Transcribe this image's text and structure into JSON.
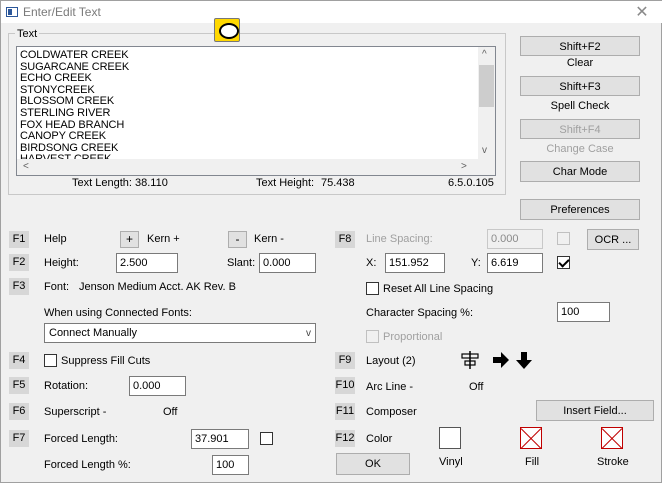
{
  "window": {
    "title": "Enter/Edit Text",
    "close": "✕"
  },
  "text_group": {
    "label": "Text",
    "lines": [
      "COLDWATER CREEK",
      "SUGARCANE CREEK",
      "ECHO CREEK",
      "STONYCREEK",
      "BLOSSOM CREEK",
      "STERLING RIVER",
      "FOX HEAD BRANCH",
      "CANOPY CREEK",
      "BIRDSONG CREEK",
      "HARVEST CREEK"
    ],
    "text_length_label": "Text Length:",
    "text_length_value": "38.110",
    "text_height_label": "Text Height:",
    "text_height_value": "75.438",
    "version": "6.5.0.105"
  },
  "right_panel": {
    "shift_f2": "Shift+F2",
    "clear": "Clear",
    "shift_f3": "Shift+F3",
    "spell_check": "Spell Check",
    "shift_f4": "Shift+F4",
    "change_case": "Change Case",
    "char_mode": "Char Mode",
    "preferences": "Preferences"
  },
  "left": {
    "f1": "F1",
    "help": "Help",
    "kern_plus_btn": "+",
    "kern_plus": "Kern +",
    "kern_minus_btn": "-",
    "kern_minus": "Kern -",
    "f2": "F2",
    "height_label": "Height:",
    "height_value": "2.500",
    "slant_label": "Slant:",
    "slant_value": "0.000",
    "f3": "F3",
    "font_label": "Font:",
    "font_value": "Jenson Medium Acct. AK Rev. B",
    "connected_label": "When using Connected Fonts:",
    "connected_value": "Connect Manually",
    "f4": "F4",
    "suppress": "Suppress Fill Cuts",
    "f5": "F5",
    "rotation_label": "Rotation:",
    "rotation_value": "0.000",
    "f6": "F6",
    "superscript_label": "Superscript -",
    "superscript_value": "Off",
    "f7": "F7",
    "forced_length_label": "Forced Length:",
    "forced_length_value": "37.901",
    "forced_pct_label": "Forced Length %:",
    "forced_pct_value": "100"
  },
  "middle": {
    "f8": "F8",
    "line_spacing_label": "Line Spacing:",
    "line_spacing_value": "0.000",
    "ocr": "OCR ...",
    "x_label": "X:",
    "x_value": "151.952",
    "y_label": "Y:",
    "y_value": "6.619",
    "reset_spacing": "Reset All Line Spacing",
    "char_spacing_label": "Character Spacing %:",
    "char_spacing_value": "100",
    "proportional": "Proportional",
    "f9": "F9",
    "layout": "Layout (2)",
    "f10": "F10",
    "arc_label": "Arc Line -",
    "arc_value": "Off",
    "f11": "F11",
    "composer": "Composer",
    "insert_field": "Insert Field...",
    "f12": "F12",
    "color": "Color",
    "ok": "OK",
    "vinyl": "Vinyl",
    "fill": "Fill",
    "stroke": "Stroke"
  }
}
